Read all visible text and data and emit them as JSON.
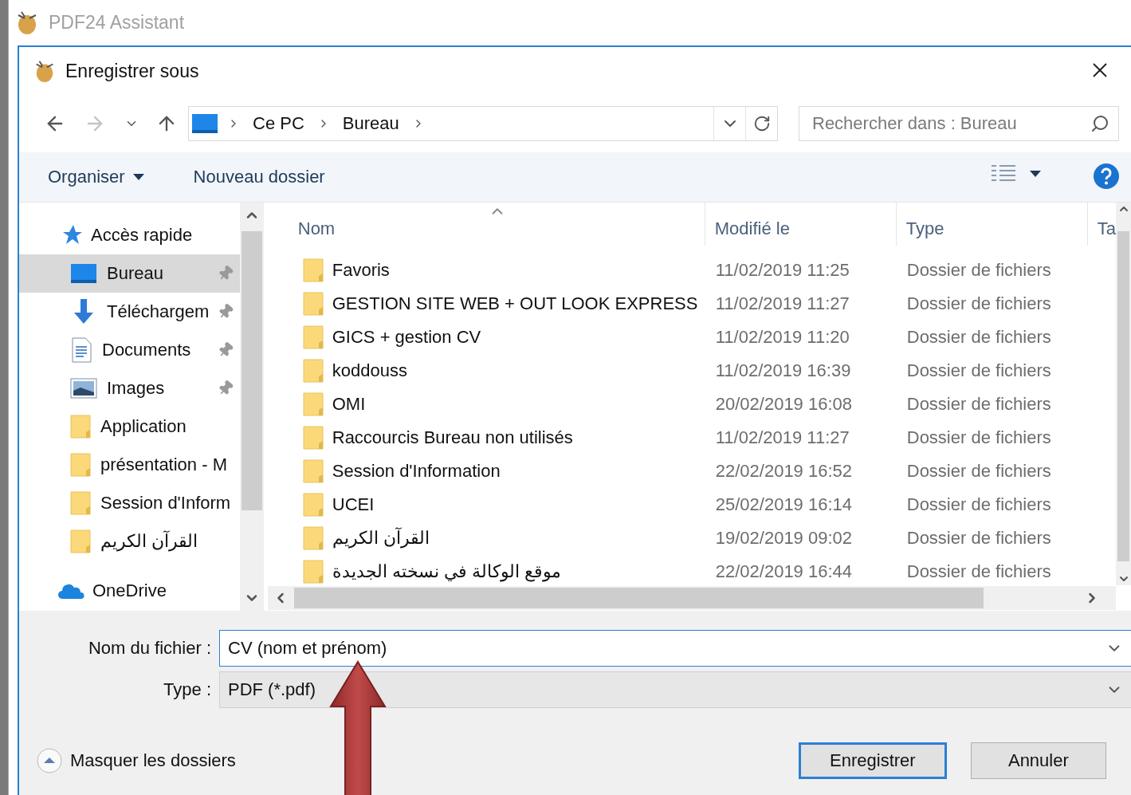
{
  "background_window": {
    "title": "PDF24 Assistant"
  },
  "dialog": {
    "title": "Enregistrer sous"
  },
  "breadcrumb": [
    "Ce PC",
    "Bureau"
  ],
  "search": {
    "placeholder": "Rechercher dans : Bureau"
  },
  "toolbar": {
    "organize": "Organiser",
    "new_folder": "Nouveau dossier"
  },
  "sidebar": {
    "header": "Accès rapide",
    "items": [
      {
        "label": "Bureau",
        "kind": "desktop",
        "pinned": true,
        "selected": true
      },
      {
        "label": "Téléchargem",
        "kind": "download",
        "pinned": true,
        "selected": false
      },
      {
        "label": "Documents",
        "kind": "documents",
        "pinned": true,
        "selected": false
      },
      {
        "label": "Images",
        "kind": "images",
        "pinned": true,
        "selected": false
      },
      {
        "label": "Application",
        "kind": "folder",
        "pinned": false,
        "selected": false
      },
      {
        "label": "présentation - M",
        "kind": "folder",
        "pinned": false,
        "selected": false
      },
      {
        "label": "Session d'Inform",
        "kind": "folder",
        "pinned": false,
        "selected": false
      },
      {
        "label": "القرآن الكريم",
        "kind": "folder",
        "pinned": false,
        "selected": false
      }
    ],
    "cloud": "OneDrive"
  },
  "table": {
    "columns": [
      "Nom",
      "Modifié le",
      "Type",
      "Ta"
    ],
    "rows": [
      {
        "name": "Favoris",
        "modified": "11/02/2019 11:25",
        "type": "Dossier de fichiers"
      },
      {
        "name": "GESTION SITE WEB + OUT LOOK EXPRESS",
        "modified": "11/02/2019 11:27",
        "type": "Dossier de fichiers"
      },
      {
        "name": "GICS + gestion CV",
        "modified": "11/02/2019 11:20",
        "type": "Dossier de fichiers"
      },
      {
        "name": "koddouss",
        "modified": "11/02/2019 16:39",
        "type": "Dossier de fichiers"
      },
      {
        "name": "OMI",
        "modified": "20/02/2019 16:08",
        "type": "Dossier de fichiers"
      },
      {
        "name": "Raccourcis Bureau non utilisés",
        "modified": "11/02/2019 11:27",
        "type": "Dossier de fichiers"
      },
      {
        "name": "Session d'Information",
        "modified": "22/02/2019 16:52",
        "type": "Dossier de fichiers"
      },
      {
        "name": "UCEI",
        "modified": "25/02/2019 16:14",
        "type": "Dossier de fichiers"
      },
      {
        "name": "القرآن الكريم",
        "modified": "19/02/2019 09:02",
        "type": "Dossier de fichiers"
      },
      {
        "name": "موقع الوكالة في نسخته الجديدة",
        "modified": "22/02/2019 16:44",
        "type": "Dossier de fichiers"
      }
    ]
  },
  "filename": {
    "label": "Nom du fichier :",
    "value": "CV (nom et prénom)"
  },
  "filetype": {
    "label": "Type :",
    "value": "PDF (*.pdf)"
  },
  "hide_folders": "Masquer les dossiers",
  "buttons": [
    {
      "label": "Enregistrer",
      "kind": "primary"
    },
    {
      "label": "Annuler",
      "kind": "default"
    }
  ]
}
